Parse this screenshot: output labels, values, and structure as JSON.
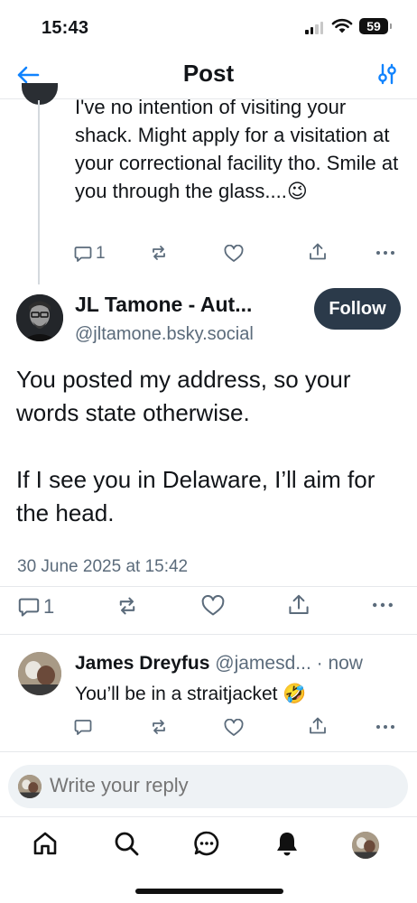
{
  "status_bar": {
    "time": "15:43",
    "battery": "59"
  },
  "header": {
    "title": "Post"
  },
  "previous_reply": {
    "text": "I've no intention of visiting your shack. Might apply for a visitation at your correctional facility tho. Smile at you through the glass....😉",
    "reply_count": "1"
  },
  "post": {
    "author_name": "JL Tamone - Aut...",
    "author_handle": "@jltamone.bsky.social",
    "follow_label": "Follow",
    "body_p1": "You posted my address, so your words state otherwise.",
    "body_p2": "If I see you in Delaware, I’ll aim for the head.",
    "date": "30 June 2025 at 15:42",
    "reply_count": "1"
  },
  "reply": {
    "author_name": "James Dreyfus",
    "meta": "@jamesd... · now",
    "text": "You’ll be in a straitjacket 🤣"
  },
  "composer": {
    "placeholder": "Write your reply"
  },
  "icons": {
    "back": "arrow-left-icon",
    "settings": "sliders-icon",
    "reply": "speech-bubble-icon",
    "repost": "repost-icon",
    "like": "heart-icon",
    "share": "share-icon",
    "more": "ellipsis-icon",
    "home": "home-icon",
    "search": "search-icon",
    "chat": "chat-icon",
    "notifications": "bell-icon"
  },
  "colors": {
    "accent": "#1083fe",
    "muted": "#5b6b7b",
    "follow_bg": "#2b3a4a",
    "composer_bg": "#eef2f5"
  }
}
